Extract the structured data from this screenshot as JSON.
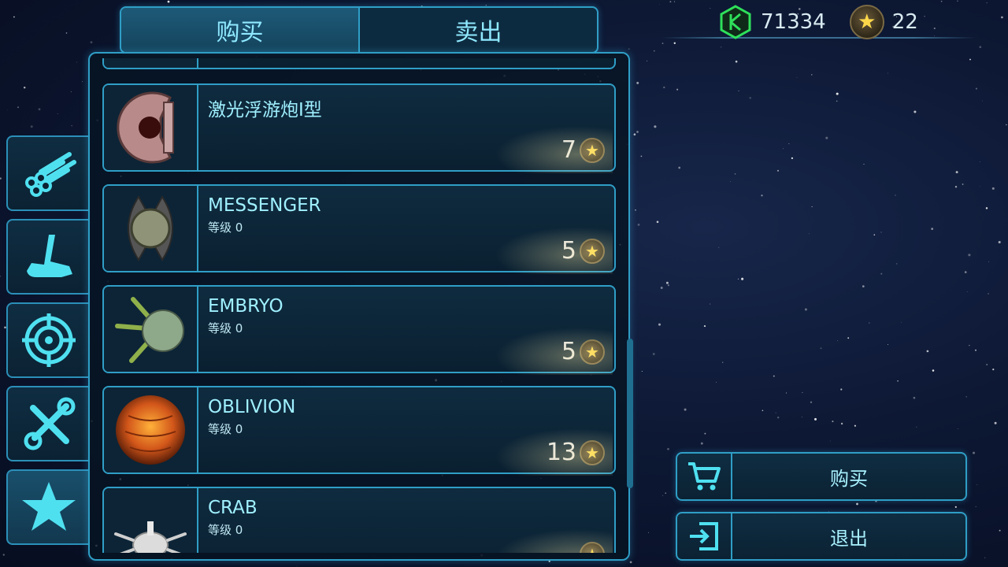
{
  "tabs": {
    "buy": "购买",
    "sell": "卖出"
  },
  "currency": {
    "credits": "71334",
    "stars": "22"
  },
  "rail": {
    "items": [
      "pipes-icon",
      "crane-icon",
      "target-icon",
      "tools-icon",
      "star-icon"
    ],
    "active": 4
  },
  "items": [
    {
      "name": "激光浮游炮I型",
      "level": "",
      "price": "7"
    },
    {
      "name": "MESSENGER",
      "level": "等级 0",
      "price": "5"
    },
    {
      "name": "EMBRYO",
      "level": "等级 0",
      "price": "5"
    },
    {
      "name": "OBLIVION",
      "level": "等级 0",
      "price": "13"
    },
    {
      "name": "CRAB",
      "level": "等级 0",
      "price": ""
    }
  ],
  "actions": {
    "buy": "购买",
    "exit": "退出"
  },
  "colors": {
    "accent": "#2f9ec6",
    "highlight": "#8fe9ff",
    "credit": "#2ee05a",
    "star": "#ffd84a"
  }
}
